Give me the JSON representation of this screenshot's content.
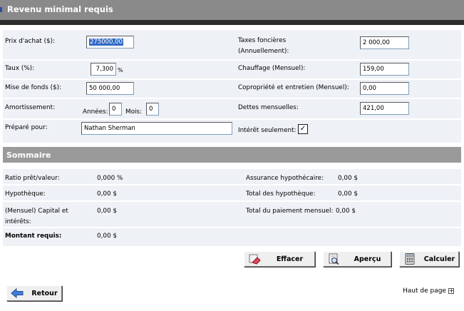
{
  "header": {
    "title": "Revenu minimal requis"
  },
  "form": {
    "purchase_price": {
      "label": "Prix d'achat ($):",
      "value": "275000,00"
    },
    "rate": {
      "label": "Taux (%):",
      "value": "7,300",
      "unit": "%"
    },
    "down_payment": {
      "label": "Mise de fonds ($):",
      "value": "50 000,00"
    },
    "amortization": {
      "label": "Amortissement:",
      "years_label": "Années:",
      "years_value": "0",
      "months_label": "Mois:",
      "months_value": "0"
    },
    "prepared_for": {
      "label": "Préparé pour:",
      "value": "Nathan Sherman"
    },
    "property_taxes": {
      "label_line1": "Taxes foncières",
      "label_line2": "(Annuellement):",
      "value": "2 000,00"
    },
    "heating": {
      "label": "Chauffage (Mensuel):",
      "value": "159,00"
    },
    "condo_fees": {
      "label": "Copropriété et entretien (Mensuel):",
      "value": "0,00"
    },
    "monthly_debts": {
      "label": "Dettes mensuelles:",
      "value": "421,00"
    },
    "interest_only": {
      "label": "Intérêt seulement:",
      "checked": true,
      "check_glyph": "✓"
    }
  },
  "summary": {
    "title": "Sommaire",
    "ltv": {
      "label": "Ratio prêt/valeur:",
      "value": "0,000 %"
    },
    "mortgage": {
      "label": "Hypothèque:",
      "value": "0,00 $"
    },
    "pi": {
      "label_line1": "(Mensuel) Capital et",
      "label_line2": "intérêts:",
      "value": "0,00 $"
    },
    "required": {
      "label": "Montant requis:",
      "value": "0,00 $"
    },
    "insurance": {
      "label": "Assurance hypothécaire:",
      "value": "0,00 $"
    },
    "total_mortgage": {
      "label": "Total des hypothèque:",
      "value": "0,00 $"
    },
    "total_payment": {
      "label": "Total du paiement mensuel:",
      "value": "0,00 $"
    }
  },
  "actions": {
    "clear": "Effacer",
    "preview": "Aperçu",
    "calculate": "Calculer",
    "back": "Retour",
    "top_link": "Haut de page",
    "top_link_icon": "+"
  }
}
